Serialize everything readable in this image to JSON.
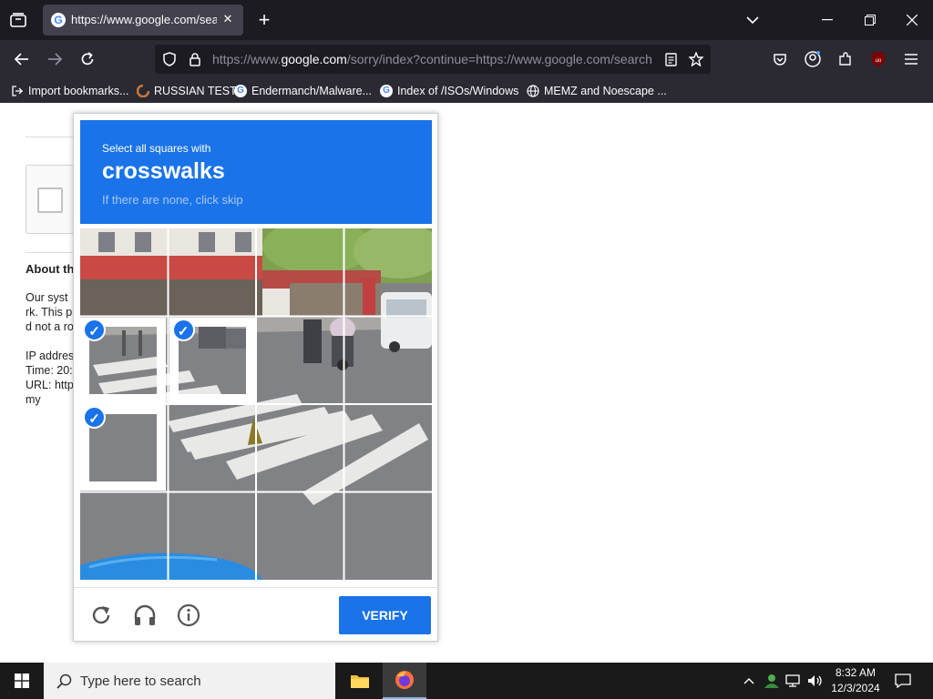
{
  "browser": {
    "tab_title": "https://www.google.com/search",
    "tab_close": "✕",
    "new_tab": "+",
    "url_prefix": "https://www.",
    "url_domain": "google.com",
    "url_rest": "/sorry/index?continue=https://www.google.com/search",
    "bookmarks": [
      {
        "label": "Import bookmarks...",
        "icon": "import-icon"
      },
      {
        "label": "RUSSIAN TEST",
        "icon": "site-icon"
      },
      {
        "label": "Endermanch/Malware...",
        "icon": "google-icon"
      },
      {
        "label": "Index of /ISOs/Windows",
        "icon": "google-icon"
      },
      {
        "label": "MEMZ and Noescape ...",
        "icon": "globe-icon"
      }
    ]
  },
  "page": {
    "about_heading": "About th",
    "lines": [
      "Our syst",
      "rk. This p",
      "d not a ro",
      "",
      "IP addres",
      "Time: 20:",
      "URL: http",
      "my"
    ]
  },
  "captcha": {
    "instruction": "Select all squares with",
    "target": "crosswalks",
    "hint": "If there are none, click skip",
    "selected_tiles": [
      4,
      5,
      8
    ],
    "verify_label": "VERIFY"
  },
  "taskbar": {
    "search_placeholder": "Type here to search",
    "time": "8:32 AM",
    "date": "12/3/2024"
  },
  "colors": {
    "accent": "#1a73e8",
    "chrome_dark": "#1c1b22",
    "chrome": "#2b2a33"
  }
}
